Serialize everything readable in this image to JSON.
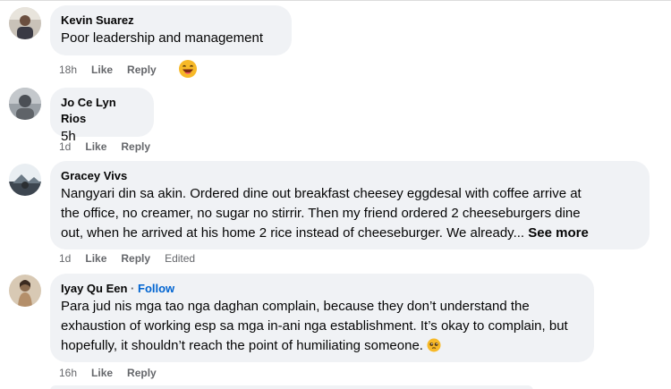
{
  "comments": [
    {
      "author": "Kevin Suarez",
      "follow": "",
      "text_lines": [
        "Poor leadership and management"
      ],
      "time": "18h",
      "like": "Like",
      "reply": "Reply",
      "edited": "",
      "avatar_icon": "user-photo-icon",
      "reaction_icon": "laughing-emoji-icon"
    },
    {
      "author": "Jo Ce Lyn Rios",
      "follow": "",
      "text_lines": [
        "5h"
      ],
      "time": "1d",
      "like": "Like",
      "reply": "Reply",
      "edited": "",
      "avatar_icon": "user-photo-icon"
    },
    {
      "author": "Gracey Vivs",
      "follow": "",
      "text_lines": [
        "Nangyari din sa akin. Ordered dine out breakfast cheesey eggdesal with coffee arrive at",
        "the office, no creamer, no sugar no stirrir. Then my friend ordered 2 cheeseburgers dine",
        "out, when he arrived at his home 2 rice instead of cheeseburger. We already..."
      ],
      "see_more": "See more",
      "time": "1d",
      "like": "Like",
      "reply": "Reply",
      "edited": "Edited",
      "avatar_icon": "user-photo-icon"
    },
    {
      "author": "Iyay Qu Een",
      "separator": "·",
      "follow": "Follow",
      "text_lines": [
        "Para jud nis mga tao nga daghan complain, because they don’t understand the",
        "exhaustion of working esp sa mga in-ani nga establishment. It’s okay to complain, but",
        "hopefully, it shouldn’t reach the point of humiliating someone."
      ],
      "inline_emoji": "pleading-face-emoji-icon",
      "time": "16h",
      "like": "Like",
      "reply": "Reply",
      "edited": "",
      "avatar_icon": "user-photo-icon"
    }
  ],
  "colors": {
    "bubble": "#f0f2f5",
    "meta_text": "#65676b",
    "follow_link": "#0064d1",
    "text": "#050505"
  }
}
